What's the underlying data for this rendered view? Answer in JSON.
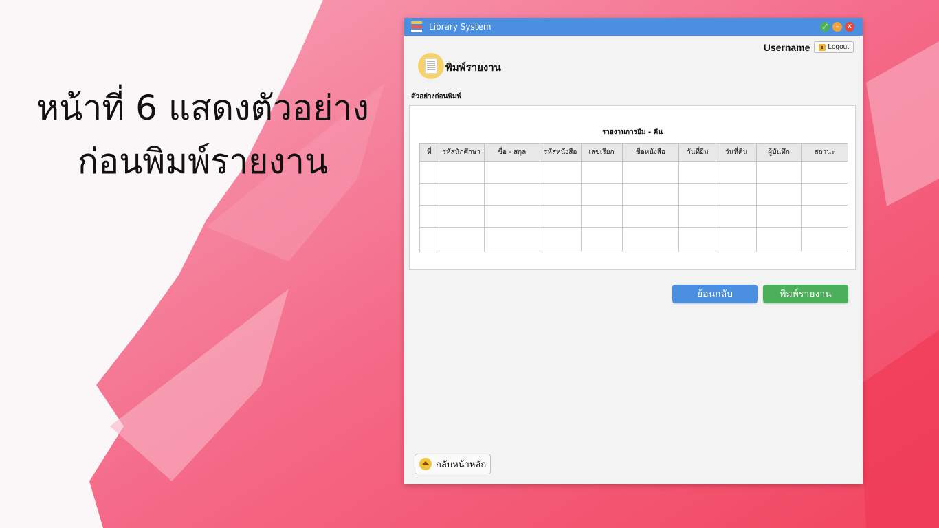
{
  "slide": {
    "title_line1": "หน้าที่ 6 แสดงตัวอย่าง",
    "title_line2": "ก่อนพิมพ์รายงาน"
  },
  "window": {
    "title": "Library System",
    "controls": [
      "restore-icon",
      "minimize-icon",
      "close-icon"
    ]
  },
  "user": {
    "username": "Username",
    "logout_label": "Logout"
  },
  "page": {
    "heading": "พิมพ์รายงาน",
    "preview_label": "ตัวอย่างก่อนพิมพ์"
  },
  "report": {
    "title": "รายงานการยืม - คืน",
    "columns": [
      "ที่",
      "รหัสนักศึกษา",
      "ชื่อ - สกุล",
      "รหัสหนังสือ",
      "เลขเรียก",
      "ชื่อหนังสือ",
      "วันที่ยืม",
      "วันที่คืน",
      "ผู้บันทึก",
      "สถานะ"
    ]
  },
  "buttons": {
    "back": "ย้อนกลับ",
    "print": "พิมพ์รายงาน",
    "home": "กลับหน้าหลัก"
  },
  "colors": {
    "titlebar": "#4a8fe0",
    "back_button": "#4a8fe0",
    "print_button": "#4cb05a",
    "background_paint": "#f25b7d"
  }
}
